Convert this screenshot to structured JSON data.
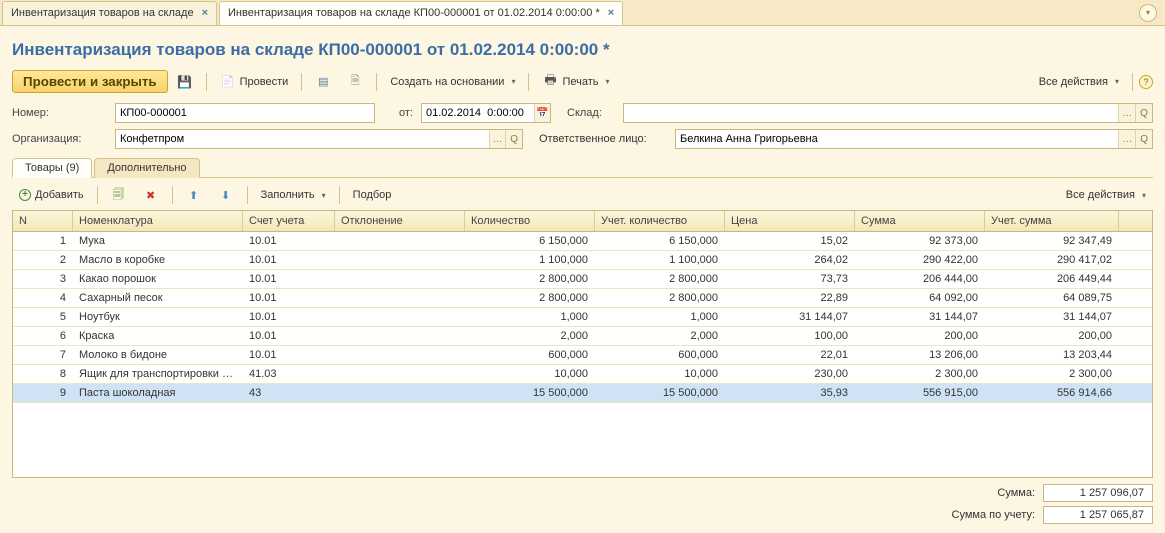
{
  "tabs": [
    {
      "label": "Инвентаризация товаров на складе",
      "active": false
    },
    {
      "label": "Инвентаризация товаров на складе КП00-000001 от 01.02.2014 0:00:00 *",
      "active": true
    }
  ],
  "title": "Инвентаризация товаров на складе КП00-000001 от 01.02.2014 0:00:00 *",
  "toolbar": {
    "primary": "Провести и закрыть",
    "post": "Провести",
    "create_based": "Создать на основании",
    "print": "Печать",
    "all_actions": "Все действия"
  },
  "form": {
    "number_lbl": "Номер:",
    "number": "КП00-000001",
    "from_lbl": "от:",
    "from": "01.02.2014  0:00:00",
    "warehouse_lbl": "Склад:",
    "warehouse": "",
    "org_lbl": "Организация:",
    "org": "Конфетпром",
    "resp_lbl": "Ответственное лицо:",
    "resp": "Белкина Анна Григорьевна"
  },
  "ptabs": {
    "goods": "Товары (9)",
    "extra": "Дополнительно"
  },
  "subtb": {
    "add": "Добавить",
    "fill": "Заполнить",
    "pick": "Подбор",
    "all_actions": "Все действия"
  },
  "cols": [
    "N",
    "Номенклатура",
    "Счет учета",
    "Отклонение",
    "Количество",
    "Учет. количество",
    "Цена",
    "Сумма",
    "Учет. сумма"
  ],
  "rows": [
    {
      "n": "1",
      "name": "Мука",
      "acc": "10.01",
      "dev": "",
      "qty": "6 150,000",
      "aqty": "6 150,000",
      "price": "15,02",
      "sum": "92 373,00",
      "asum": "92 347,49"
    },
    {
      "n": "2",
      "name": "Масло в коробке",
      "acc": "10.01",
      "dev": "",
      "qty": "1 100,000",
      "aqty": "1 100,000",
      "price": "264,02",
      "sum": "290 422,00",
      "asum": "290 417,02"
    },
    {
      "n": "3",
      "name": "Какао порошок",
      "acc": "10.01",
      "dev": "",
      "qty": "2 800,000",
      "aqty": "2 800,000",
      "price": "73,73",
      "sum": "206 444,00",
      "asum": "206 449,44"
    },
    {
      "n": "4",
      "name": "Сахарный песок",
      "acc": "10.01",
      "dev": "",
      "qty": "2 800,000",
      "aqty": "2 800,000",
      "price": "22,89",
      "sum": "64 092,00",
      "asum": "64 089,75"
    },
    {
      "n": "5",
      "name": "Ноутбук",
      "acc": "10.01",
      "dev": "",
      "qty": "1,000",
      "aqty": "1,000",
      "price": "31 144,07",
      "sum": "31 144,07",
      "asum": "31 144,07"
    },
    {
      "n": "6",
      "name": "Краска",
      "acc": "10.01",
      "dev": "",
      "qty": "2,000",
      "aqty": "2,000",
      "price": "100,00",
      "sum": "200,00",
      "asum": "200,00"
    },
    {
      "n": "7",
      "name": "Молоко в бидоне",
      "acc": "10.01",
      "dev": "",
      "qty": "600,000",
      "aqty": "600,000",
      "price": "22,01",
      "sum": "13 206,00",
      "asum": "13 203,44"
    },
    {
      "n": "8",
      "name": "Ящик для транспортировки п...",
      "acc": "41.03",
      "dev": "",
      "qty": "10,000",
      "aqty": "10,000",
      "price": "230,00",
      "sum": "2 300,00",
      "asum": "2 300,00"
    },
    {
      "n": "9",
      "name": "Паста шоколадная",
      "acc": "43",
      "dev": "",
      "qty": "15 500,000",
      "aqty": "15 500,000",
      "price": "35,93",
      "sum": "556 915,00",
      "asum": "556 914,66"
    }
  ],
  "footer": {
    "sum_lbl": "Сумма:",
    "sum": "1 257 096,07",
    "asum_lbl": "Сумма по учету:",
    "asum": "1 257 065,87"
  }
}
